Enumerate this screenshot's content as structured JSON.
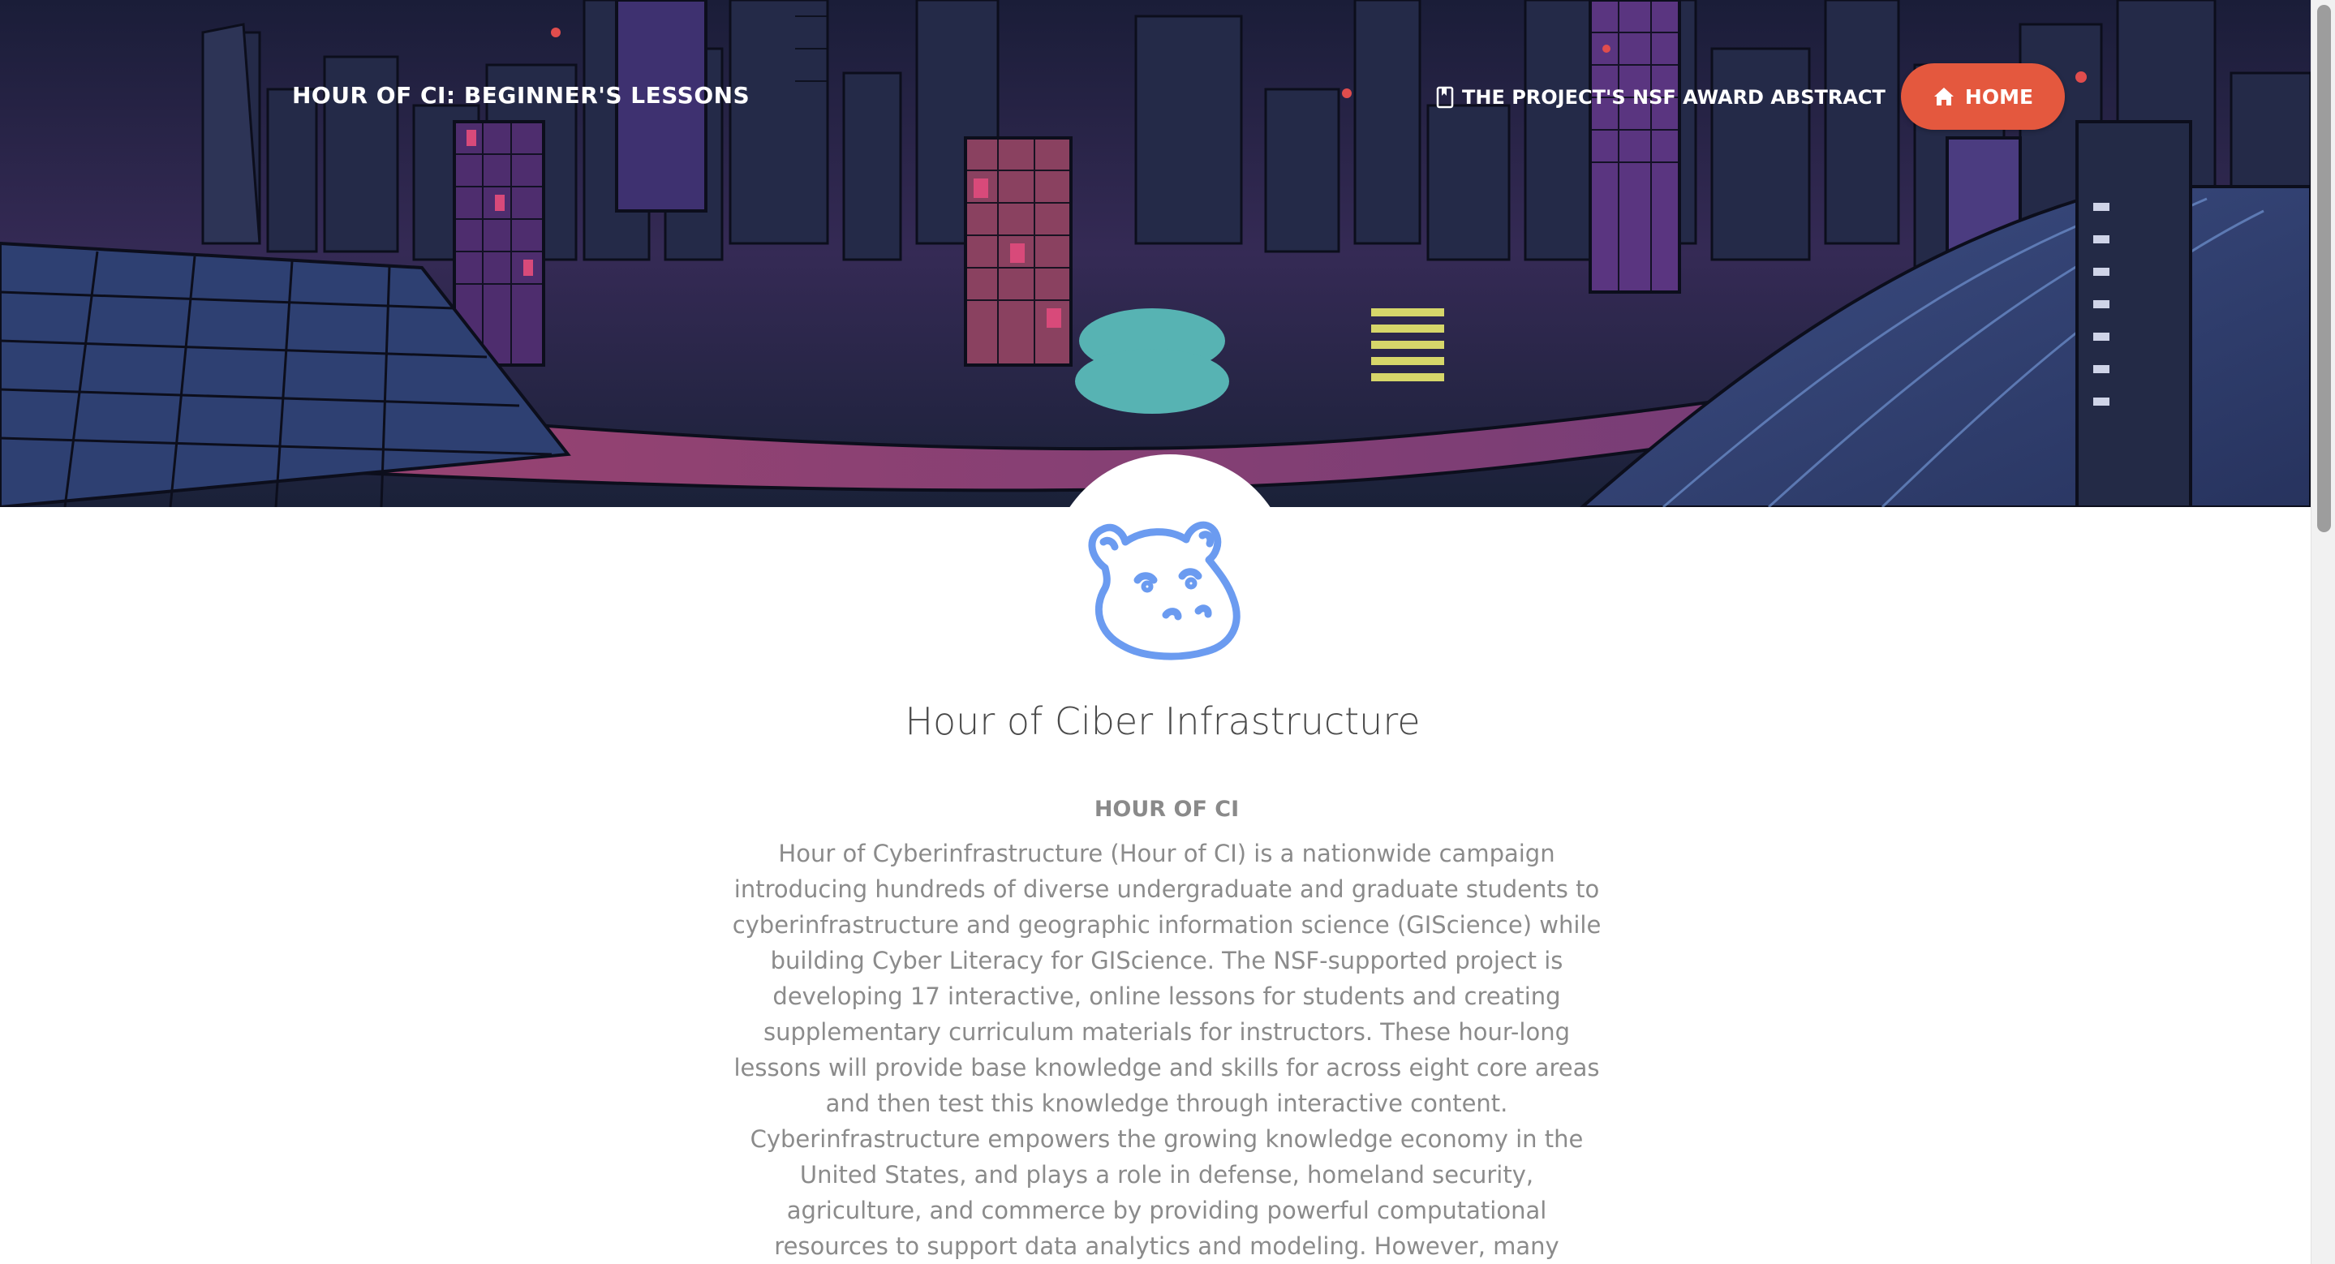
{
  "navbar": {
    "brand": "HOUR OF CI: BEGINNER'S LESSONS",
    "abstract_link": "THE PROJECT'S NSF AWARD ABSTRACT",
    "abstract_icon": "book-icon",
    "home_button": "HOME",
    "home_icon": "house-icon",
    "accent_color": "#e4583e"
  },
  "hero": {
    "image": "night-city-illustration"
  },
  "avatar": {
    "icon": "hippo-mascot-icon",
    "color": "#6b9bf0"
  },
  "main": {
    "title": "Hour of Ciber Infrastructure",
    "subheading": "HOUR OF CI",
    "body": "Hour of Cyberinfrastructure (Hour of CI) is a nationwide campaign introducing hundreds of diverse undergraduate and graduate students to cyberinfrastructure and geographic information science (GIScience) while building Cyber Literacy for GIScience. The NSF-supported project is developing 17 interactive, online lessons for students and creating supplementary curriculum materials for instructors. These hour-long lessons will provide base knowledge and skills for across eight core areas and then test this knowledge through interactive content. Cyberinfrastructure empowers the growing knowledge economy in the United States, and plays a role in defense, homeland security, agriculture, and commerce by providing powerful computational resources to support data analytics and modeling. However, many scientific"
  }
}
